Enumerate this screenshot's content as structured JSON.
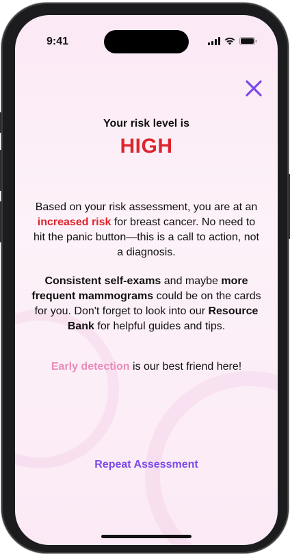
{
  "status": {
    "time": "9:41"
  },
  "header": {
    "intro": "Your risk level is",
    "level": "HIGH"
  },
  "paragraph1": {
    "part1": "Based on your risk assessment, you are at an ",
    "highlight": "increased risk",
    "part2": " for breast cancer. No need to hit the panic button—this is a call to action, not a diagnosis."
  },
  "paragraph2": {
    "bold1": "Consistent self-exams",
    "text1": " and maybe ",
    "bold2": "more frequent mammograms",
    "text2": " could be on the cards for you. Don't forget to look into our ",
    "bold3": "Resource Bank",
    "text3": " for helpful guides and tips."
  },
  "paragraph3": {
    "highlight": "Early detection",
    "text": " is our best friend here!"
  },
  "actions": {
    "repeat_label": "Repeat Assessment"
  },
  "colors": {
    "accent": "#7c4ae8",
    "danger": "#e0242b",
    "pink": "#e98bb8"
  },
  "icons": {
    "close": "close-icon"
  }
}
